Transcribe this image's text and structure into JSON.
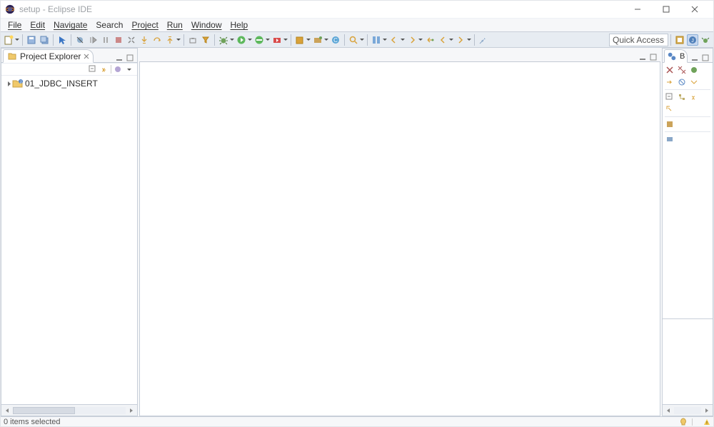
{
  "window": {
    "title": "setup - Eclipse IDE"
  },
  "menu": {
    "file": "File",
    "edit": "Edit",
    "navigate": "Navigate",
    "search": "Search",
    "project": "Project",
    "run": "Run",
    "window": "Window",
    "help": "Help"
  },
  "toolbar": {
    "quick_access": "Quick Access"
  },
  "project_explorer": {
    "title": "Project Explorer",
    "items": [
      {
        "name": "01_JDBC_INSERT"
      }
    ]
  },
  "right_view": {
    "title": "B"
  },
  "status": {
    "text": "0 items selected"
  }
}
